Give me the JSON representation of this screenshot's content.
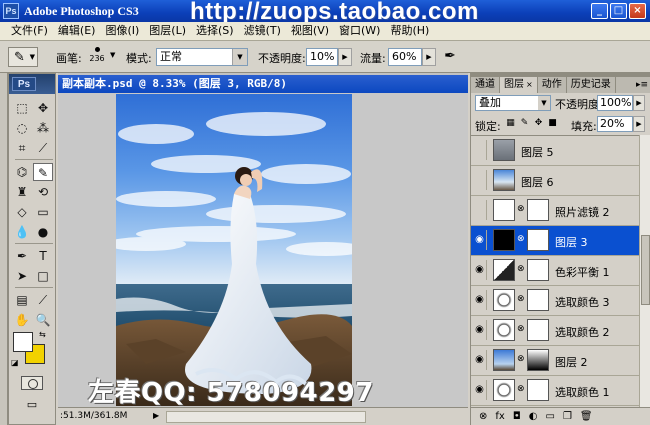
{
  "titlebar": {
    "app_title": "Adobe Photoshop CS3",
    "watermark_url": "http://zuops.taobao.com",
    "buttons": {
      "minimize": "_",
      "maximize": "□",
      "close": "×"
    }
  },
  "menu": [
    "文件(F)",
    "编辑(E)",
    "图像(I)",
    "图层(L)",
    "选择(S)",
    "滤镜(T)",
    "视图(V)",
    "窗口(W)",
    "帮助(H)"
  ],
  "options": {
    "brush_label": "画笔:",
    "brush_size": "236",
    "mode_label": "模式:",
    "mode_value": "正常",
    "opacity_label": "不透明度:",
    "opacity_value": "10%",
    "flow_label": "流量:",
    "flow_value": "60%"
  },
  "toolbox": {
    "logo": "Ps"
  },
  "document": {
    "title": "副本副本.psd @ 8.33% (图层 3, RGB/8)",
    "status": ":51.3M/361.8M",
    "watermark": "左春QQ: 578094297"
  },
  "panel": {
    "tabs": [
      "通道",
      "图层",
      "动作",
      "历史记录"
    ],
    "blend_mode": "叠加",
    "opacity_label": "不透明度:",
    "opacity_value": "100%",
    "lock_label": "锁定:",
    "fill_label": "填充:",
    "fill_value": "20%",
    "layers": [
      {
        "name": "图层 5",
        "visible": false
      },
      {
        "name": "图层 6",
        "visible": false
      },
      {
        "name": "照片滤镜 2",
        "visible": false
      },
      {
        "name": "图层 3",
        "visible": true
      },
      {
        "name": "色彩平衡 1",
        "visible": true
      },
      {
        "name": "选取颜色 3",
        "visible": true
      },
      {
        "name": "选取颜色 2",
        "visible": true
      },
      {
        "name": "图层 2",
        "visible": true
      },
      {
        "name": "选取颜色 1",
        "visible": true
      }
    ]
  },
  "colors": {
    "foreground": "#ffffff",
    "background": "#f2d200",
    "selection": "#0a50d0"
  }
}
